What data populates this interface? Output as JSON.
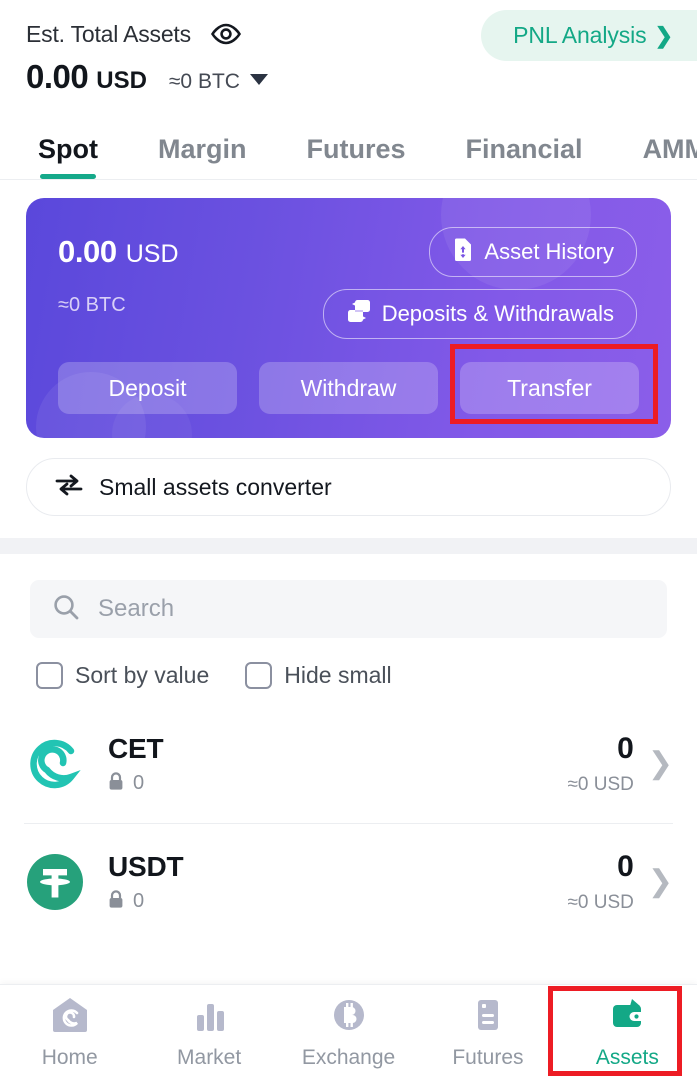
{
  "header": {
    "est_label": "Est. Total Assets",
    "eye_icon": "eye-icon",
    "total_amount": "0.00",
    "total_currency": "USD",
    "total_btc": "≈0 BTC",
    "pnl_label": "PNL Analysis",
    "pnl_chevron": "❯",
    "pnl_color": "#13a886"
  },
  "tabs": [
    {
      "label": "Spot",
      "active": true
    },
    {
      "label": "Margin",
      "active": false
    },
    {
      "label": "Futures",
      "active": false
    },
    {
      "label": "Financial",
      "active": false
    },
    {
      "label": "AMM",
      "active": false
    }
  ],
  "balance_card": {
    "amount": "0.00",
    "currency": "USD",
    "btc": "≈0  BTC",
    "asset_history_label": "Asset History",
    "asset_history_icon": "document-updown-icon",
    "deposits_withdrawals_label": "Deposits & Withdrawals",
    "deposits_withdrawals_icon": "transfer-document-icon",
    "actions": [
      {
        "label": "Deposit",
        "highlighted": false
      },
      {
        "label": "Withdraw",
        "highlighted": false
      },
      {
        "label": "Transfer",
        "highlighted": true
      }
    ],
    "gradient_from": "#5a48db",
    "gradient_to": "#8b5ee9"
  },
  "converter": {
    "label": "Small assets converter",
    "icon": "swap-arrows-icon"
  },
  "search": {
    "placeholder": "Search",
    "icon": "search-icon"
  },
  "filters": [
    {
      "label": "Sort by value",
      "checked": false
    },
    {
      "label": "Hide small",
      "checked": false
    }
  ],
  "assets": [
    {
      "symbol": "CET",
      "logo": "cet-coin-logo",
      "logo_color": "#22c4b3",
      "locked_icon": "lock-icon",
      "locked_amount": "0",
      "amount": "0",
      "usd_value": "≈0 USD",
      "chevron": "❯"
    },
    {
      "symbol": "USDT",
      "logo": "usdt-coin-logo",
      "logo_color": "#26a17b",
      "locked_icon": "lock-icon",
      "locked_amount": "0",
      "amount": "0",
      "usd_value": "≈0 USD",
      "chevron": "❯"
    }
  ],
  "bottom_nav": [
    {
      "label": "Home",
      "icon": "home-icon",
      "active": false
    },
    {
      "label": "Market",
      "icon": "bar-chart-icon",
      "active": false
    },
    {
      "label": "Exchange",
      "icon": "bitcoin-circle-icon",
      "active": false
    },
    {
      "label": "Futures",
      "icon": "futures-card-icon",
      "active": false
    },
    {
      "label": "Assets",
      "icon": "wallet-icon",
      "active": true
    }
  ],
  "annotations": {
    "highlight_color": "#ed1c24",
    "boxes": [
      "transfer-button-highlight",
      "assets-nav-highlight"
    ]
  }
}
